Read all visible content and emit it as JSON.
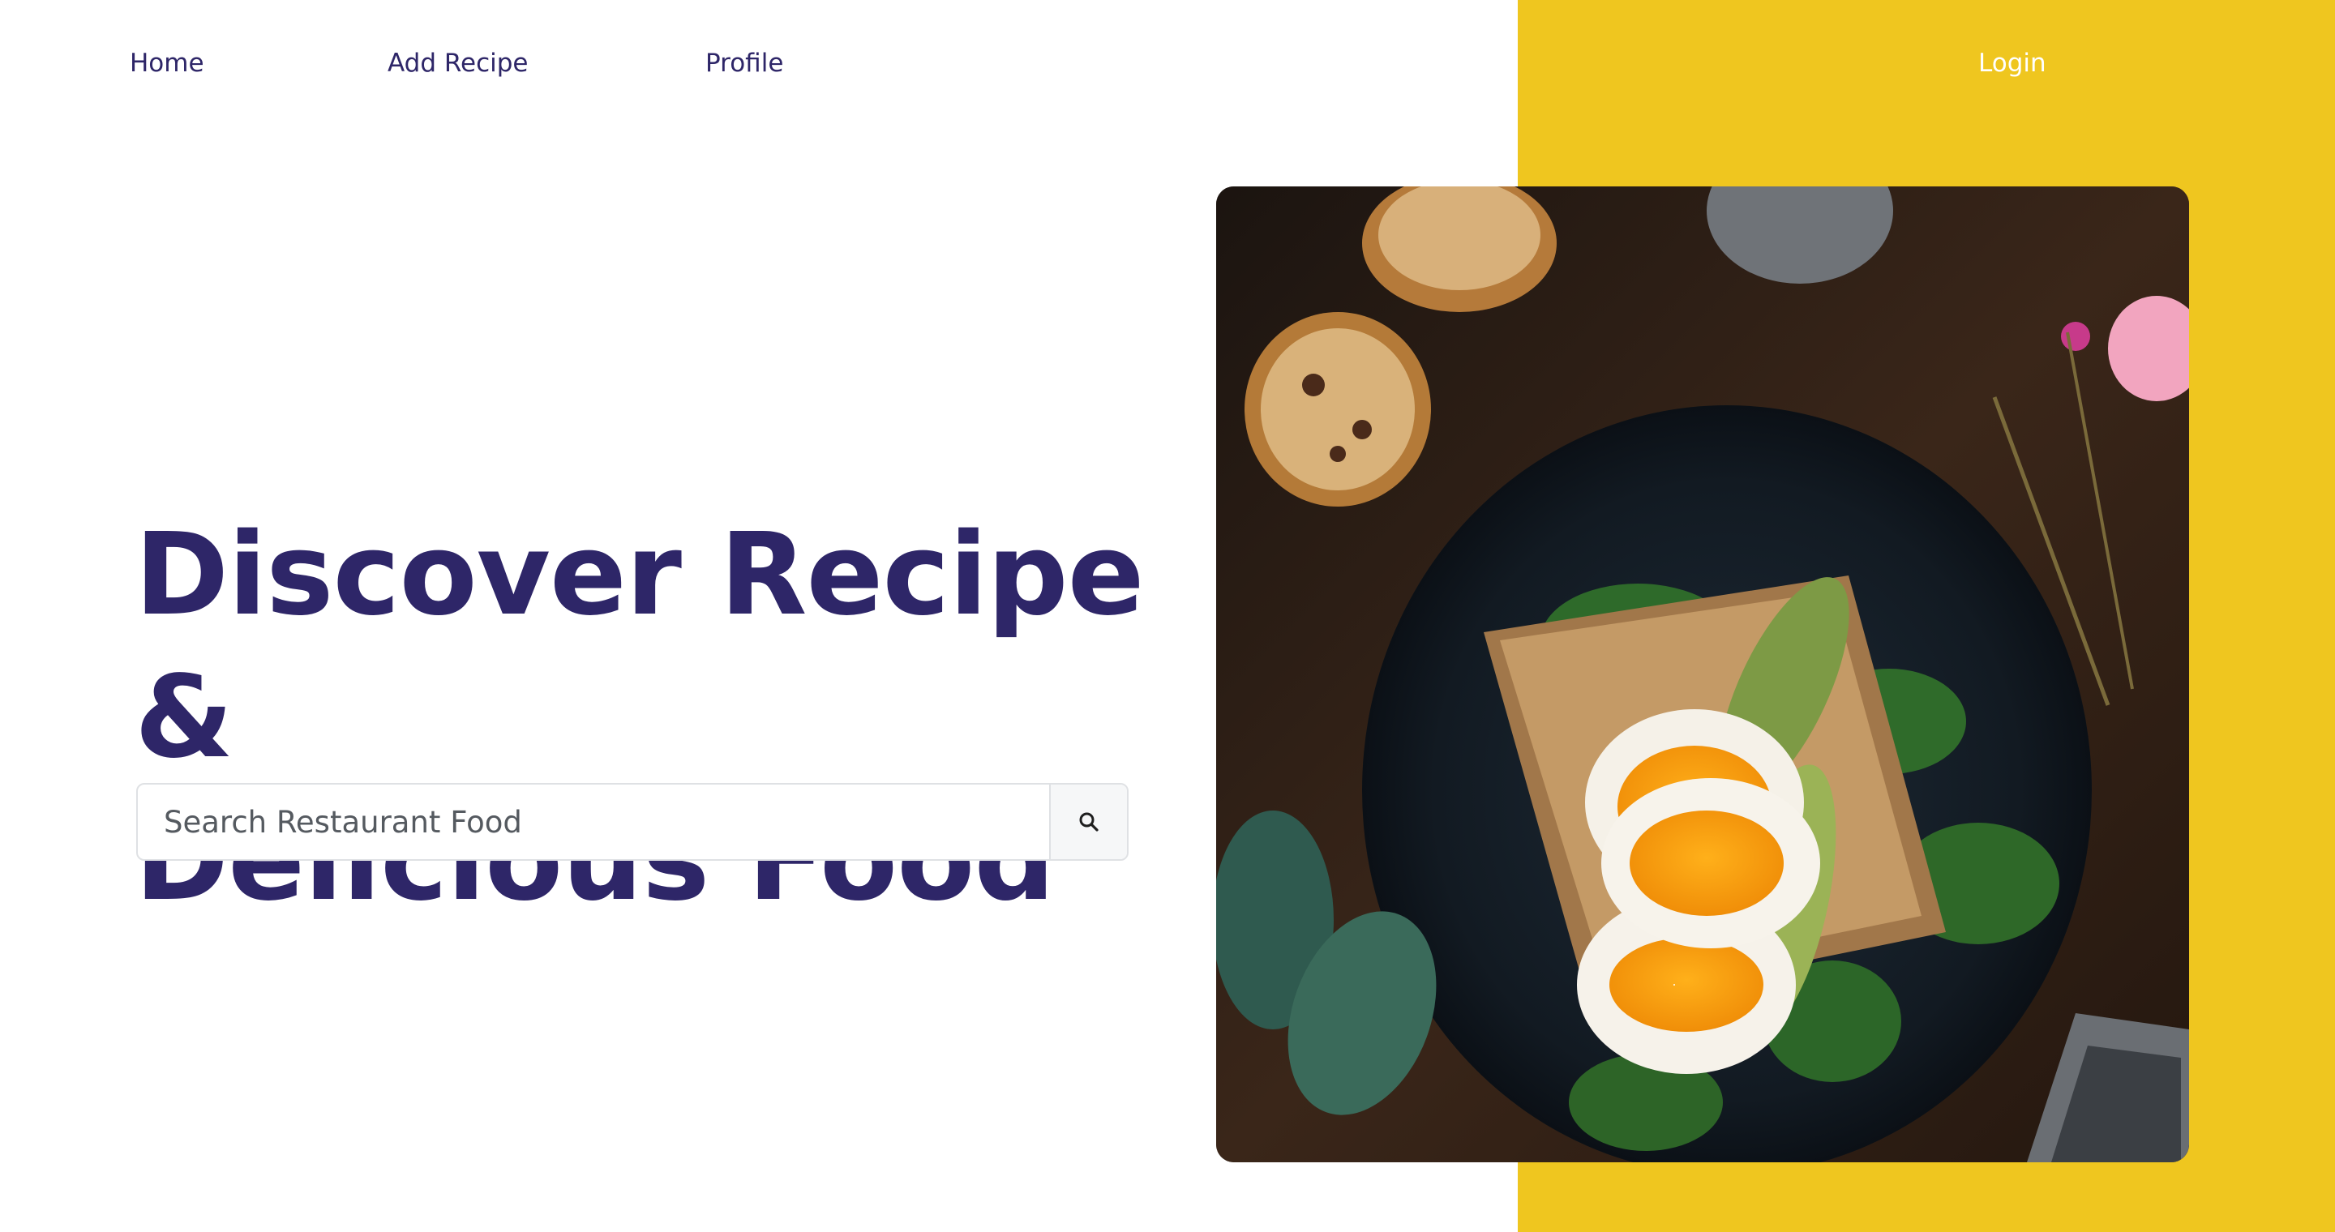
{
  "nav": {
    "home": "Home",
    "add_recipe": "Add Recipe",
    "profile": "Profile",
    "login": "Login"
  },
  "hero": {
    "title_line1": "Discover Recipe &",
    "title_line2": "Delicious Food"
  },
  "search": {
    "placeholder": "Search Restaurant Food",
    "button_icon": "search-icon"
  },
  "image": {
    "subject": "food-photo"
  },
  "colors": {
    "brand_navy": "#2e2668",
    "accent_yellow": "#efc61f",
    "background": "#ffffff"
  }
}
